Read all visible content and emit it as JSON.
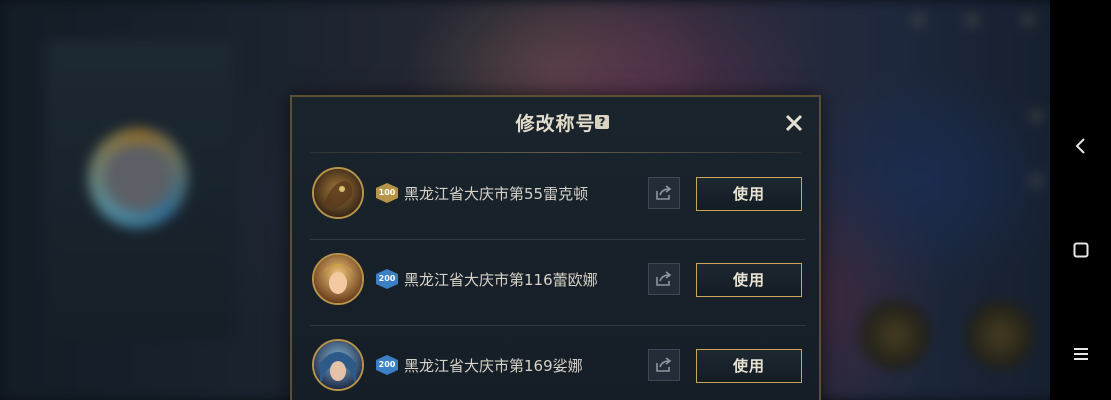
{
  "dialog": {
    "title": "修改称号",
    "help_icon": "?",
    "close_icon": "close-icon"
  },
  "titles": [
    {
      "level": "100",
      "level_color": "#b8944a",
      "name": "黑龙江省大庆市第55雷克顿",
      "share_icon": "share-icon",
      "use_label": "使用",
      "avatar_color": "#6b4a2a"
    },
    {
      "level": "200",
      "level_color": "#3d7fc4",
      "name": "黑龙江省大庆市第116蕾欧娜",
      "share_icon": "share-icon",
      "use_label": "使用",
      "avatar_color": "#c89a4a"
    },
    {
      "level": "200",
      "level_color": "#3d7fc4",
      "name": "黑龙江省大庆市第169娑娜",
      "share_icon": "share-icon",
      "use_label": "使用",
      "avatar_color": "#3e6a9a"
    }
  ],
  "system_nav": [
    "back-icon",
    "home-icon",
    "menu-icon"
  ]
}
